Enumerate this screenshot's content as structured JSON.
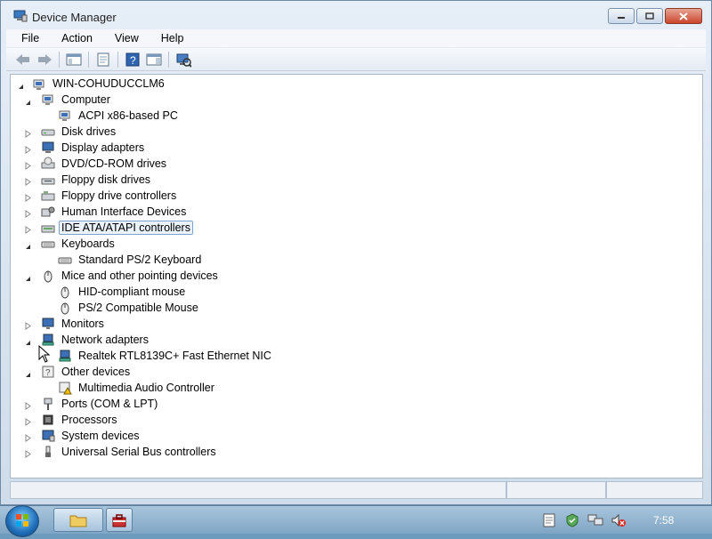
{
  "window": {
    "title": "Device Manager"
  },
  "menu": [
    "File",
    "Action",
    "View",
    "Help"
  ],
  "tree": {
    "root": "WIN-COHUDUCCLM6",
    "items": [
      {
        "label": "Computer",
        "level": 1,
        "state": "expanded",
        "icon": "computer-icon"
      },
      {
        "label": "ACPI x86-based PC",
        "level": 2,
        "state": "leaf",
        "icon": "computer-icon"
      },
      {
        "label": "Disk drives",
        "level": 1,
        "state": "collapsed",
        "icon": "disk-drive-icon"
      },
      {
        "label": "Display adapters",
        "level": 1,
        "state": "collapsed",
        "icon": "display-adapter-icon"
      },
      {
        "label": "DVD/CD-ROM drives",
        "level": 1,
        "state": "collapsed",
        "icon": "dvd-drive-icon"
      },
      {
        "label": "Floppy disk drives",
        "level": 1,
        "state": "collapsed",
        "icon": "floppy-drive-icon"
      },
      {
        "label": "Floppy drive controllers",
        "level": 1,
        "state": "collapsed",
        "icon": "floppy-controller-icon"
      },
      {
        "label": "Human Interface Devices",
        "level": 1,
        "state": "collapsed",
        "icon": "hid-icon"
      },
      {
        "label": "IDE ATA/ATAPI controllers",
        "level": 1,
        "state": "collapsed",
        "icon": "ide-controller-icon",
        "selected": true
      },
      {
        "label": "Keyboards",
        "level": 1,
        "state": "expanded",
        "icon": "keyboard-icon"
      },
      {
        "label": "Standard PS/2 Keyboard",
        "level": 2,
        "state": "leaf",
        "icon": "keyboard-icon"
      },
      {
        "label": "Mice and other pointing devices",
        "level": 1,
        "state": "expanded",
        "icon": "mouse-icon"
      },
      {
        "label": "HID-compliant mouse",
        "level": 2,
        "state": "leaf",
        "icon": "mouse-icon"
      },
      {
        "label": "PS/2 Compatible Mouse",
        "level": 2,
        "state": "leaf",
        "icon": "mouse-icon"
      },
      {
        "label": "Monitors",
        "level": 1,
        "state": "collapsed",
        "icon": "monitor-icon"
      },
      {
        "label": "Network adapters",
        "level": 1,
        "state": "expanded",
        "icon": "network-adapter-icon"
      },
      {
        "label": "Realtek RTL8139C+ Fast Ethernet NIC",
        "level": 2,
        "state": "leaf",
        "icon": "network-adapter-icon"
      },
      {
        "label": "Other devices",
        "level": 1,
        "state": "expanded",
        "icon": "unknown-device-icon"
      },
      {
        "label": "Multimedia Audio Controller",
        "level": 2,
        "state": "leaf",
        "icon": "warning-device-icon"
      },
      {
        "label": "Ports (COM & LPT)",
        "level": 1,
        "state": "collapsed",
        "icon": "port-icon"
      },
      {
        "label": "Processors",
        "level": 1,
        "state": "collapsed",
        "icon": "processor-icon"
      },
      {
        "label": "System devices",
        "level": 1,
        "state": "collapsed",
        "icon": "system-device-icon"
      },
      {
        "label": "Universal Serial Bus controllers",
        "level": 1,
        "state": "collapsed",
        "icon": "usb-icon"
      }
    ]
  },
  "taskbar": {
    "clock": "7:58"
  }
}
